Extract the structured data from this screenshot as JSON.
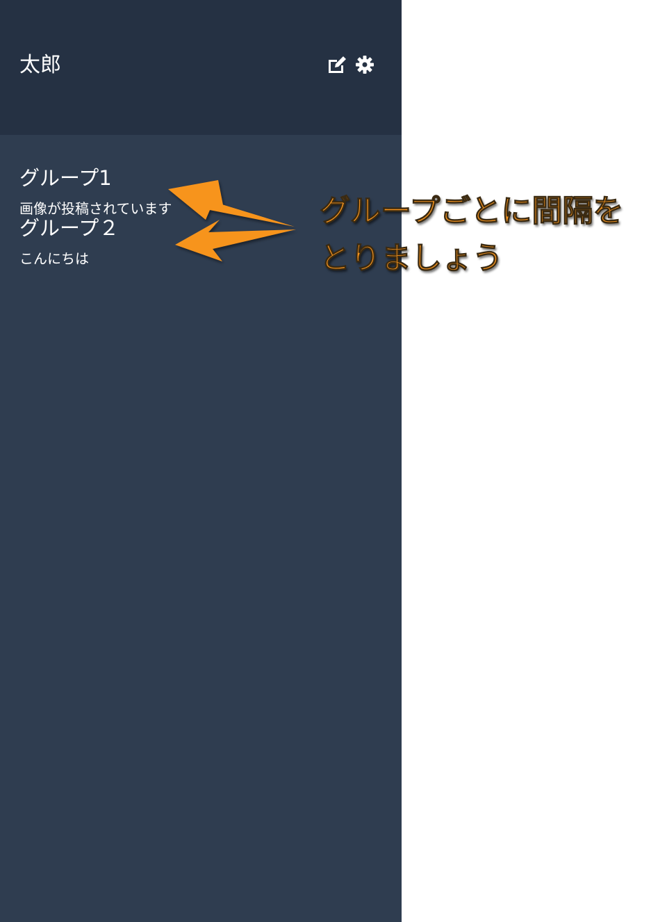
{
  "header": {
    "user_name": "太郎",
    "icons": [
      "edit-icon",
      "gear-icon"
    ]
  },
  "groups": [
    {
      "name": "グループ1",
      "last_message": "画像が投稿されています"
    },
    {
      "name": "グループ２",
      "last_message": "こんにちは"
    }
  ],
  "annotation": {
    "line1": "グループごとに間隔を",
    "line2": "とりましょう",
    "color": "#f7941d"
  },
  "colors": {
    "header_bg": "#253143",
    "sidebar_bg": "#2f3d50",
    "page_bg": "#ffffff"
  }
}
